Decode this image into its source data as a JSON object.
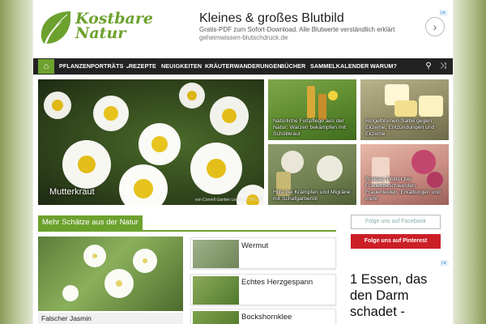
{
  "logo": {
    "line1": "Kostbare",
    "line2": "Natur"
  },
  "ad_top": {
    "title": "Kleines & großes Blutbild",
    "subtitle": "Gratis-PDF zum Sofort-Download. Alle Blutwerte verständlich erklärt",
    "url": "geheimwissen-blutschdruck.de",
    "arrow": "›",
    "badge": "i✕"
  },
  "nav": {
    "home_icon": "⌂",
    "items": [
      {
        "label": "PFLANZENPORTRÄTS ⌄"
      },
      {
        "label": "REZEPTE"
      },
      {
        "label": "NEUIGKEITEN"
      },
      {
        "label": "KRÄUTERWANDERUNGEN"
      },
      {
        "label": "BÜCHER"
      },
      {
        "label": "SAMMELKALENDER"
      },
      {
        "label": "WARUM?"
      }
    ],
    "search_icon": "⚲",
    "shuffle_icon": "⤨"
  },
  "hero": {
    "label": "Mutterkraut",
    "credit": "von Cornell Garden Leads CC BY 2.0"
  },
  "tiles": [
    {
      "text": "Natürliche Fußpflege aus der Natur: Warzen bekämpfen mit Schöllkraut"
    },
    {
      "text": "Ringelblumen-Salbe gegen Ekzeme, Entzündungen und Ekzeme"
    },
    {
      "text": "Hilfe bei Krämpfen und Migräne mit Schafgarbenöl"
    },
    {
      "text": "Rotklee-Tinktur bei Frauenbeschwerden, Frauenleiden, Erkältungen und mehr"
    }
  ],
  "section": {
    "title": "Mehr Schätze aus der Natur"
  },
  "big_article": {
    "caption": "Falscher Jasmin"
  },
  "list": [
    {
      "label": "Wermut"
    },
    {
      "label": "Echtes Herzgespann"
    },
    {
      "label": "Bockshornklee"
    }
  ],
  "sidebar": {
    "facebook": "Folge uns auf Facebook",
    "pinterest": "Folge uns auf Pinterest",
    "ad_badge": "i✕",
    "ad_text": "1 Essen, das den Darm schadet -"
  },
  "colors": {
    "accent": "#6da12e",
    "nav_bg": "#222222",
    "pinterest": "#cb1f27"
  }
}
